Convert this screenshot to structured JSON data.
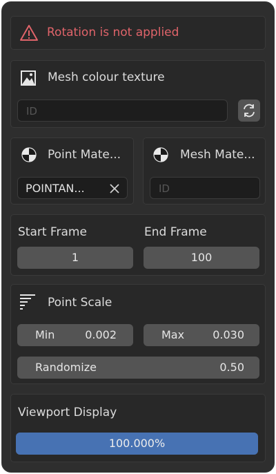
{
  "warning": {
    "icon": "warning-triangle-icon",
    "text": "Rotation is not applied",
    "color": "#e0646a"
  },
  "mesh_texture": {
    "icon": "image-icon",
    "title": "Mesh colour texture",
    "id_placeholder": "ID",
    "refresh_icon": "refresh-icon"
  },
  "point_material": {
    "icon": "material-sphere-icon",
    "title": "Point Mate...",
    "value": "POINTAN...",
    "clear_icon": "close-icon"
  },
  "mesh_material": {
    "icon": "material-sphere-icon",
    "title": "Mesh Mate...",
    "id_placeholder": "ID"
  },
  "frames": {
    "start_label": "Start Frame",
    "start_value": "1",
    "end_label": "End Frame",
    "end_value": "100"
  },
  "point_scale": {
    "icon": "scale-lines-icon",
    "title": "Point Scale",
    "min_label": "Min",
    "min_value": "0.002",
    "max_label": "Max",
    "max_value": "0.030",
    "randomize_label": "Randomize",
    "randomize_value": "0.50"
  },
  "viewport": {
    "label": "Viewport Display",
    "progress_text": "100.000%",
    "progress_fraction": 1.0,
    "accent": "#4772b3"
  }
}
